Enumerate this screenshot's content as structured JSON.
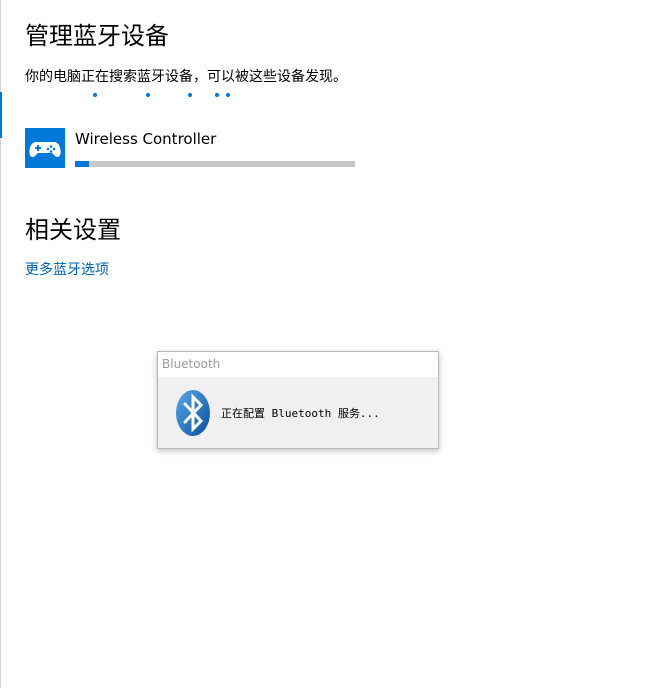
{
  "page": {
    "title": "管理蓝牙设备",
    "discover_text": "你的电脑正在搜索蓝牙设备，可以被这些设备发现。"
  },
  "devices": [
    {
      "name": "Wireless Controller",
      "icon": "gamepad-icon",
      "progress": 0.05
    }
  ],
  "related": {
    "title": "相关设置",
    "link": "更多蓝牙选项"
  },
  "bluetooth_dialog": {
    "title": "Bluetooth",
    "message": "正在配置 Bluetooth 服务...",
    "icon": "bluetooth-icon"
  },
  "colors": {
    "accent": "#0078d7",
    "link": "#0063b1",
    "track": "#c8c8c8"
  }
}
